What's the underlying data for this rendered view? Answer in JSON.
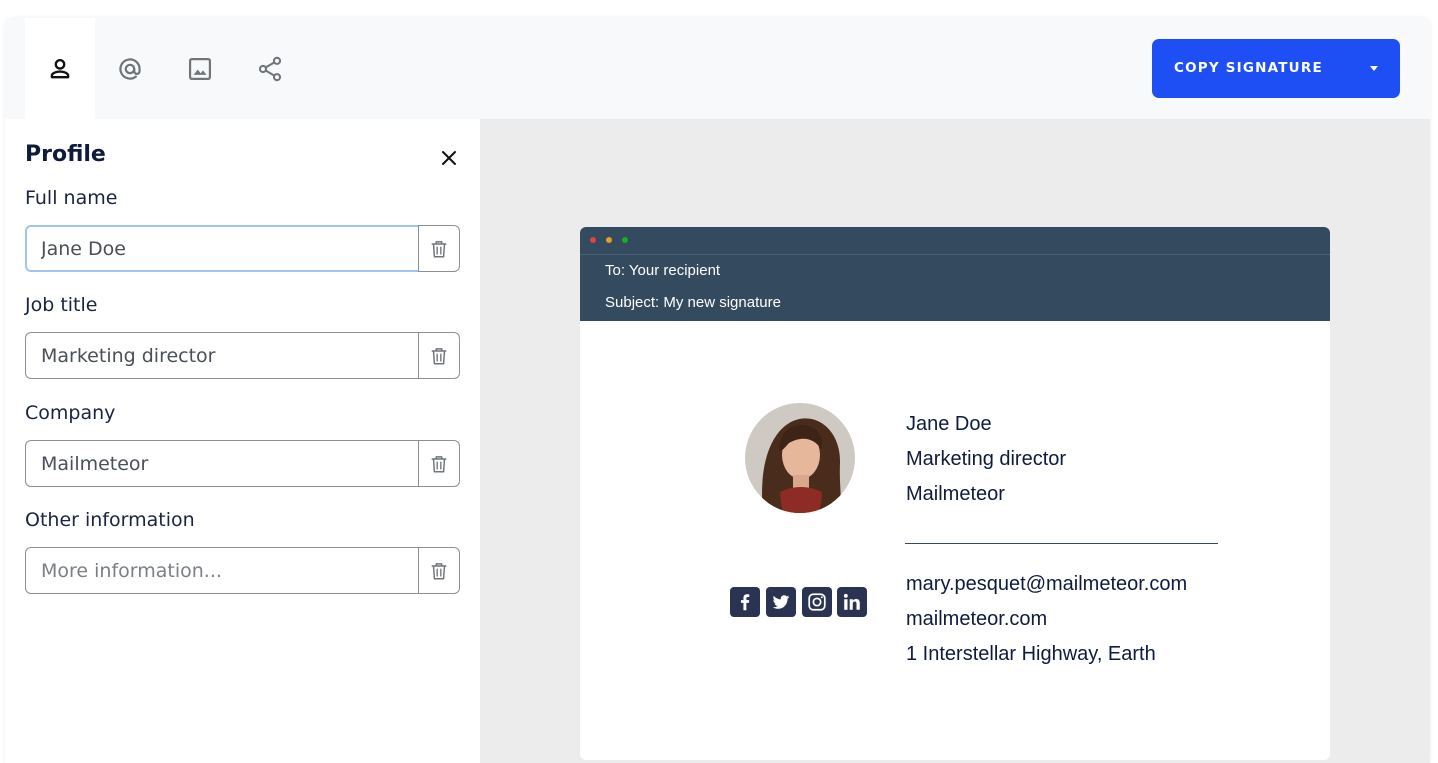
{
  "toolbar": {
    "tabs": [
      {
        "icon": "person-icon",
        "active": true
      },
      {
        "icon": "at-icon",
        "active": false
      },
      {
        "icon": "image-icon",
        "active": false
      },
      {
        "icon": "share-icon",
        "active": false
      }
    ],
    "copy_button_label": "COPY SIGNATURE",
    "accent_color": "#1d4ff5"
  },
  "profile_panel": {
    "title": "Profile",
    "fields": [
      {
        "label": "Full name",
        "value": "Jane Doe",
        "placeholder": "",
        "focused": true
      },
      {
        "label": "Job title",
        "value": "Marketing director",
        "placeholder": ""
      },
      {
        "label": "Company",
        "value": "Mailmeteor",
        "placeholder": ""
      },
      {
        "label": "Other information",
        "value": "",
        "placeholder": "More information..."
      }
    ]
  },
  "email_preview": {
    "to": "To: Your recipient",
    "subject": "Subject: My new signature",
    "header_color": "#344a5e",
    "window_dots": [
      "#e0443e",
      "#dea123",
      "#1aab29"
    ],
    "signature": {
      "name": "Jane Doe",
      "job_title": "Marketing director",
      "company": "Mailmeteor",
      "email": "mary.pesquet@mailmeteor.com",
      "website": "mailmeteor.com",
      "address": "1 Interstellar Highway, Earth",
      "social_icons": [
        "facebook-icon",
        "twitter-icon",
        "instagram-icon",
        "linkedin-icon"
      ]
    }
  }
}
